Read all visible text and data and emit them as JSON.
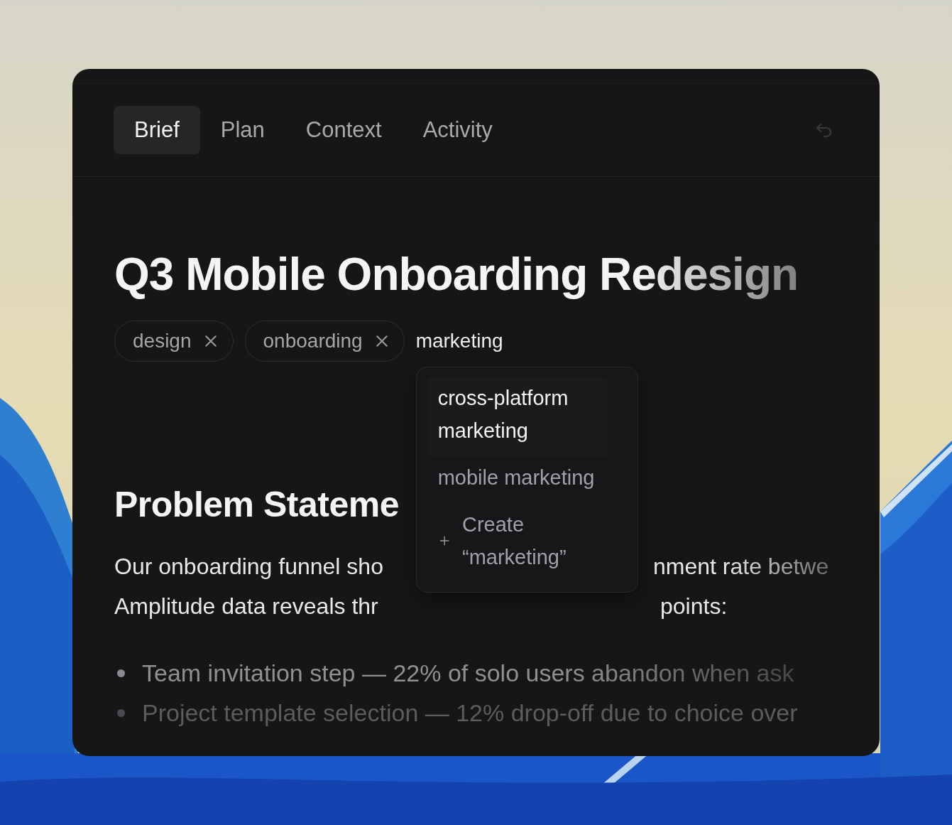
{
  "tabs": [
    {
      "label": "Brief",
      "selected": true
    },
    {
      "label": "Plan",
      "selected": false
    },
    {
      "label": "Context",
      "selected": false
    },
    {
      "label": "Activity",
      "selected": false
    }
  ],
  "title": "Q3 Mobile Onboarding Redesign",
  "tags": [
    {
      "label": "design"
    },
    {
      "label": "onboarding"
    }
  ],
  "tag_input": {
    "value": "marketing"
  },
  "suggestions": [
    {
      "label": "cross-platform marketing",
      "kind": "option",
      "selected": true
    },
    {
      "label": "mobile marketing",
      "kind": "option",
      "selected": false
    },
    {
      "label": "Create “marketing”",
      "kind": "create",
      "selected": false
    }
  ],
  "section_heading": "Problem Stateme",
  "paragraph_lines": [
    {
      "left": "Our onboarding funnel sho",
      "right": "nment rate betwe"
    },
    {
      "left": "Amplitude data reveals thr",
      "right": "points:"
    }
  ],
  "bullets": [
    "Team invitation step — 22% of solo users abandon when ask",
    "Project template selection — 12% drop-off due to choice over"
  ]
}
